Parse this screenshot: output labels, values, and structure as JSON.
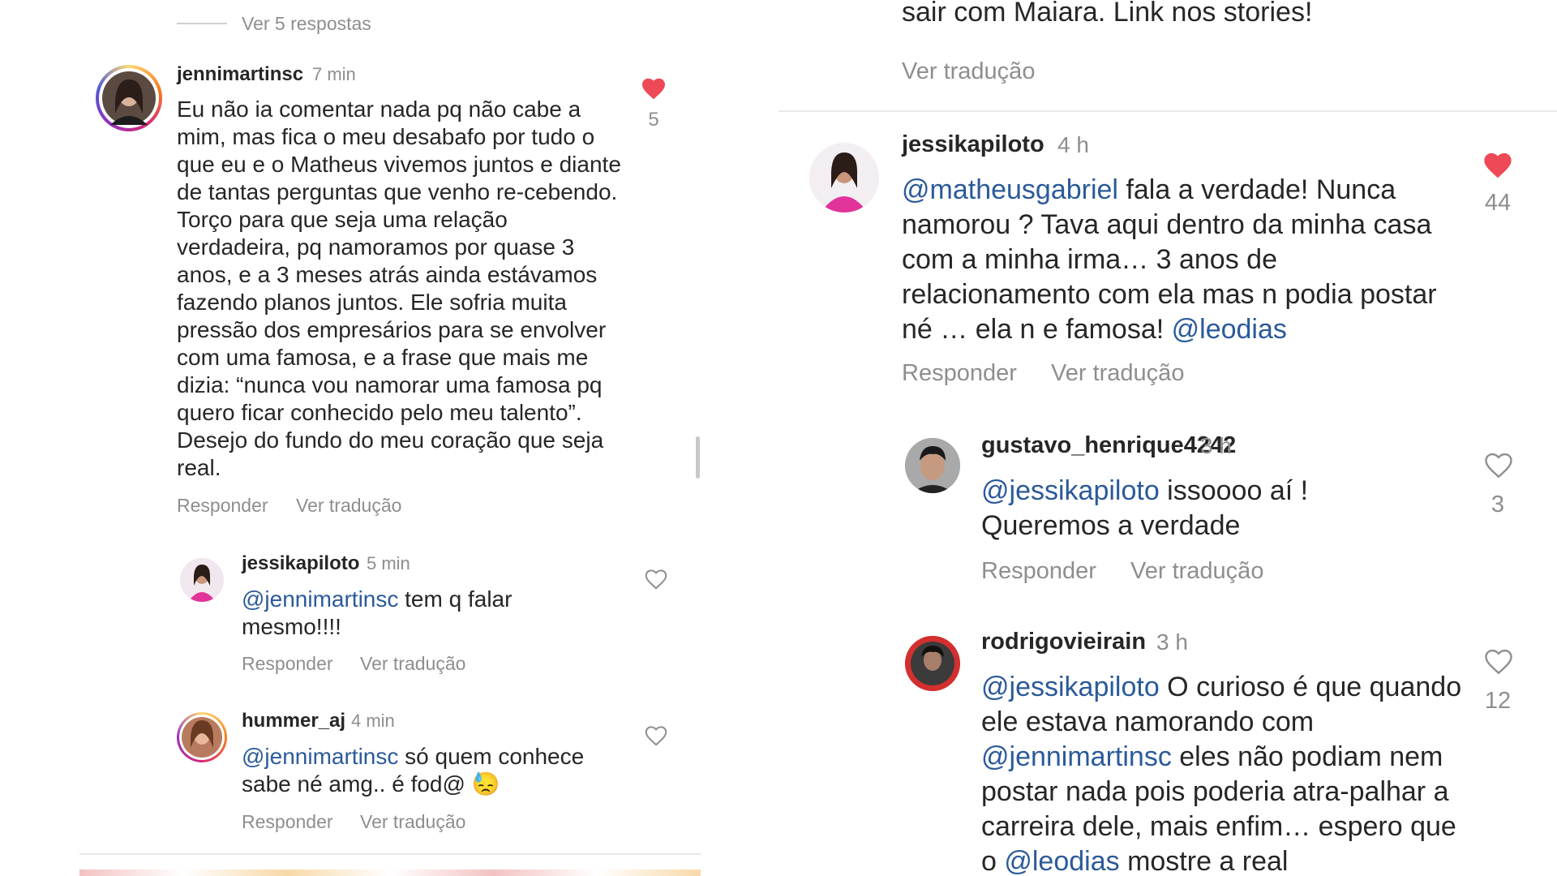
{
  "left": {
    "view_replies": "Ver 5 respostas",
    "main_comment": {
      "username": "jennimartinsc",
      "time": "7 min",
      "text": "Eu não ia comentar nada pq não cabe a mim, mas fica o meu desabafo por tudo o que eu e o Matheus vivemos juntos e diante de tantas perguntas que venho re-cebendo. Torço para que seja uma relação verdadeira, pq namoramos por quase 3 anos, e a 3 meses atrás ainda estávamos fazendo planos juntos. Ele sofria muita pressão dos empresários para se envolver com uma famosa, e a frase que mais me dizia: “nunca vou namorar uma famosa pq quero ficar conhecido pelo meu talento”. Desejo do fundo do meu coração que seja real.",
      "likes": "5",
      "reply_label": "Responder",
      "translate_label": "Ver tradução"
    },
    "replies": [
      {
        "username": "jessikapiloto",
        "time": "5 min",
        "mention": "@jennimartinsc",
        "text": " tem q falar mesmo!!!!",
        "reply_label": "Responder",
        "translate_label": "Ver tradução"
      },
      {
        "username": "hummer_aj",
        "time": "4 min",
        "mention": "@jennimartinsc",
        "text": " só quem conhece sabe né amg.. é fod@ 😓",
        "reply_label": "Responder",
        "translate_label": "Ver tradução"
      }
    ]
  },
  "right": {
    "top_text": "sair com Maiara. Link nos stories!",
    "top_translate": "Ver tradução",
    "main_comment": {
      "username": "jessikapiloto",
      "time": "4 h",
      "mention_start": "@matheusgabriel",
      "text": " fala a verdade! Nunca namorou ? Tava aqui dentro da minha casa com a minha irma… 3 anos de relacionamento com ela mas n podia postar né … ela n e famosa! ",
      "mention_end": "@leodias",
      "likes": "44",
      "reply_label": "Responder",
      "translate_label": "Ver tradução"
    },
    "replies": [
      {
        "username": "gustavo_henrique4242",
        "time": "3 h",
        "mention": "@jessikapiloto",
        "text": " issoooo aí ! Queremos a verdade",
        "likes": "3",
        "reply_label": "Responder",
        "translate_label": "Ver tradução"
      },
      {
        "username": "rodrigovieirain",
        "time": "3 h",
        "mention": "@jessikapiloto",
        "text_a": " O curioso é que quando ele estava namorando com ",
        "mention_b": "@jennimartinsc",
        "text_b": " eles não podiam nem postar nada pois poderia atra-palhar a carreira dele, mais enfim… espero que o ",
        "mention_c": "@leodias",
        "text_c": " mostre a real",
        "likes": "12"
      }
    ]
  },
  "colors": {
    "like_red": "#ed4956",
    "mention_blue": "#2b5a9a",
    "muted_gray": "#8e8e8e"
  }
}
